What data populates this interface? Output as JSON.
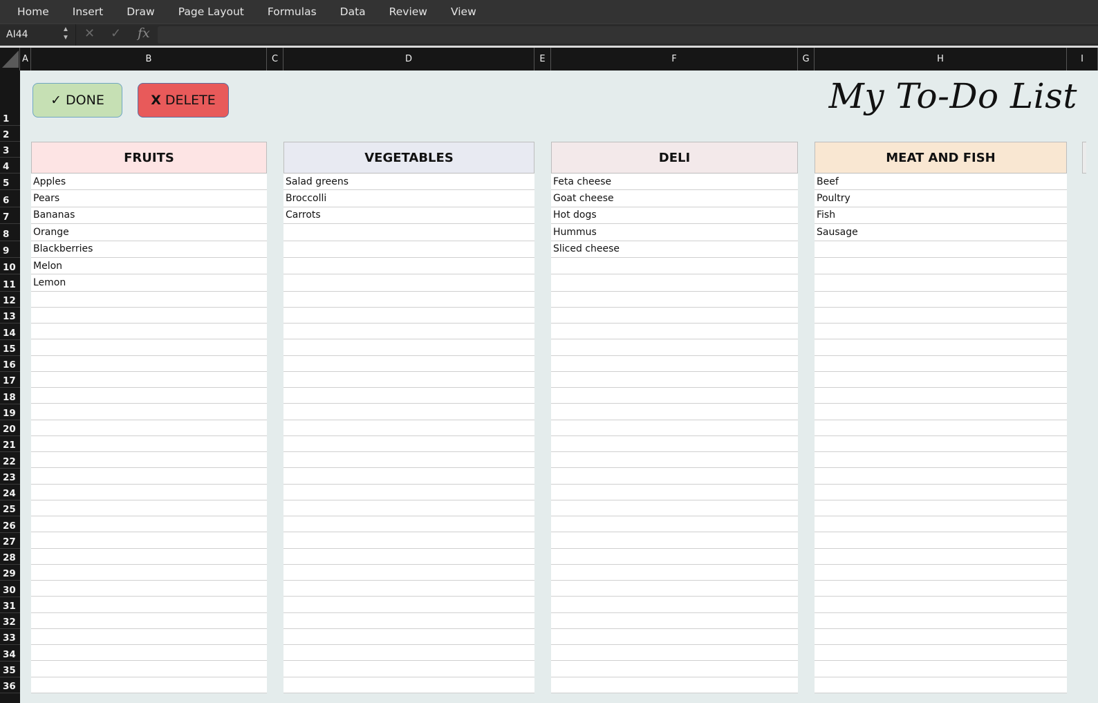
{
  "menubar": {
    "items": [
      "Home",
      "Insert",
      "Draw",
      "Page Layout",
      "Formulas",
      "Data",
      "Review",
      "View"
    ]
  },
  "formula_bar": {
    "name_box": "AI44",
    "cancel_icon": "✕",
    "enter_icon": "✓",
    "fx_label": "fx",
    "formula_value": ""
  },
  "columns": [
    "A",
    "B",
    "C",
    "D",
    "E",
    "F",
    "G",
    "H",
    "I"
  ],
  "rows": [
    "1",
    "2",
    "3",
    "4",
    "5",
    "6",
    "7",
    "8",
    "9",
    "10",
    "11",
    "12",
    "13",
    "14",
    "15",
    "16",
    "17",
    "18",
    "19",
    "20",
    "21",
    "22",
    "23",
    "24",
    "25",
    "26",
    "27",
    "28",
    "29",
    "30",
    "31",
    "32",
    "33",
    "34",
    "35",
    "36"
  ],
  "sheet": {
    "title": "My To-Do List",
    "done_button": {
      "glyph": "✓",
      "label": "DONE",
      "color": "#c6e0b4"
    },
    "delete_button": {
      "glyph": "X",
      "label": "DELETE",
      "color": "#e85a5a"
    },
    "lists": [
      {
        "title": "FRUITS",
        "color": "#fde4e4",
        "items": [
          "Apples",
          "Pears",
          "Bananas",
          "Orange",
          "Blackberries",
          "Melon",
          "Lemon"
        ]
      },
      {
        "title": "VEGETABLES",
        "color": "#e8eaf2",
        "items": [
          "Salad greens",
          "Broccolli",
          "Carrots"
        ]
      },
      {
        "title": "DELI",
        "color": "#f3e9ea",
        "items": [
          "Feta cheese",
          "Goat cheese",
          "Hot dogs",
          "Hummus",
          "Sliced cheese"
        ]
      },
      {
        "title": "MEAT AND FISH",
        "color": "#f9e7d2",
        "items": [
          "Beef",
          "Poultry",
          "Fish",
          "Sausage"
        ]
      }
    ]
  }
}
